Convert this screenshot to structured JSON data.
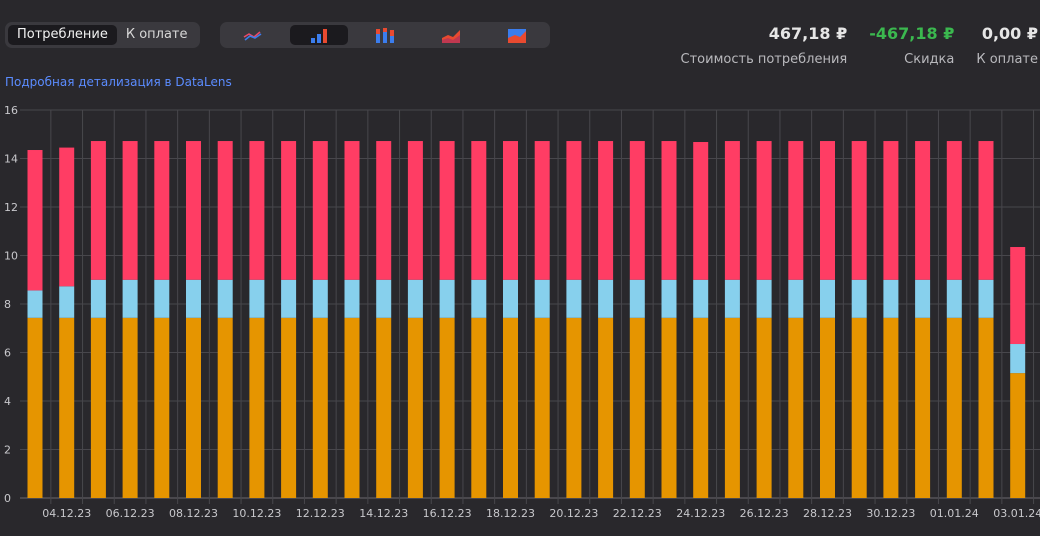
{
  "tabs": [
    {
      "label": "Потребление",
      "active": true
    },
    {
      "label": "К оплате",
      "active": false
    }
  ],
  "chart_types": [
    {
      "icon": "line-chart-icon",
      "active": false
    },
    {
      "icon": "bar-chart-icon",
      "active": true
    },
    {
      "icon": "stacked-bar-chart-icon",
      "active": false
    },
    {
      "icon": "area-chart-icon",
      "active": false
    },
    {
      "icon": "stacked-area-chart-icon",
      "active": false
    }
  ],
  "summary": {
    "consumption": {
      "value": "467,18 ₽",
      "label": "Стоимость потребления"
    },
    "discount": {
      "value": "-467,18 ₽",
      "label": "Скидка"
    },
    "to_pay": {
      "value": "0,00 ₽",
      "label": "К оплате"
    }
  },
  "link_text": "Подробная детализация в DataLens",
  "colors": {
    "background": "#29282c",
    "grid": "#48474c",
    "series_orange": "#e69500",
    "series_blue": "#87d0ed",
    "series_red": "#ff3d64",
    "accent_link": "#5b8cff",
    "discount_green": "#3bb84f"
  },
  "chart_data": {
    "type": "bar",
    "stacked": true,
    "ylim": [
      0,
      16
    ],
    "y_ticks": [
      0,
      2,
      4,
      6,
      8,
      10,
      12,
      14,
      16
    ],
    "grid": true,
    "x_tick_labels": [
      "04.12.23",
      "06.12.23",
      "08.12.23",
      "10.12.23",
      "12.12.23",
      "14.12.23",
      "16.12.23",
      "18.12.23",
      "20.12.23",
      "22.12.23",
      "24.12.23",
      "26.12.23",
      "28.12.23",
      "30.12.23",
      "01.01.24",
      "03.01.24"
    ],
    "categories": [
      "03.12.23",
      "04.12.23",
      "05.12.23",
      "06.12.23",
      "07.12.23",
      "08.12.23",
      "09.12.23",
      "10.12.23",
      "11.12.23",
      "12.12.23",
      "13.12.23",
      "14.12.23",
      "15.12.23",
      "16.12.23",
      "17.12.23",
      "18.12.23",
      "19.12.23",
      "20.12.23",
      "21.12.23",
      "22.12.23",
      "23.12.23",
      "24.12.23",
      "25.12.23",
      "26.12.23",
      "27.12.23",
      "28.12.23",
      "29.12.23",
      "30.12.23",
      "31.12.23",
      "01.01.24",
      "02.01.24",
      "03.01.24"
    ],
    "series": [
      {
        "color": "#e69500",
        "values": [
          7.43,
          7.43,
          7.43,
          7.43,
          7.43,
          7.43,
          7.43,
          7.43,
          7.43,
          7.43,
          7.43,
          7.43,
          7.43,
          7.43,
          7.43,
          7.43,
          7.43,
          7.43,
          7.43,
          7.43,
          7.43,
          7.43,
          7.43,
          7.43,
          7.43,
          7.43,
          7.43,
          7.43,
          7.43,
          7.43,
          7.43,
          5.15
        ]
      },
      {
        "color": "#87d0ed",
        "values": [
          1.13,
          1.3,
          1.57,
          1.57,
          1.57,
          1.57,
          1.57,
          1.57,
          1.57,
          1.57,
          1.57,
          1.57,
          1.57,
          1.57,
          1.57,
          1.57,
          1.57,
          1.57,
          1.57,
          1.57,
          1.57,
          1.57,
          1.57,
          1.57,
          1.57,
          1.57,
          1.57,
          1.57,
          1.57,
          1.57,
          1.57,
          1.2
        ]
      },
      {
        "color": "#ff3d64",
        "values": [
          5.79,
          5.72,
          5.72,
          5.72,
          5.72,
          5.72,
          5.72,
          5.72,
          5.72,
          5.72,
          5.72,
          5.72,
          5.72,
          5.72,
          5.72,
          5.72,
          5.72,
          5.72,
          5.72,
          5.72,
          5.72,
          5.68,
          5.72,
          5.72,
          5.72,
          5.72,
          5.72,
          5.72,
          5.72,
          5.72,
          5.72,
          4.0
        ]
      }
    ]
  }
}
